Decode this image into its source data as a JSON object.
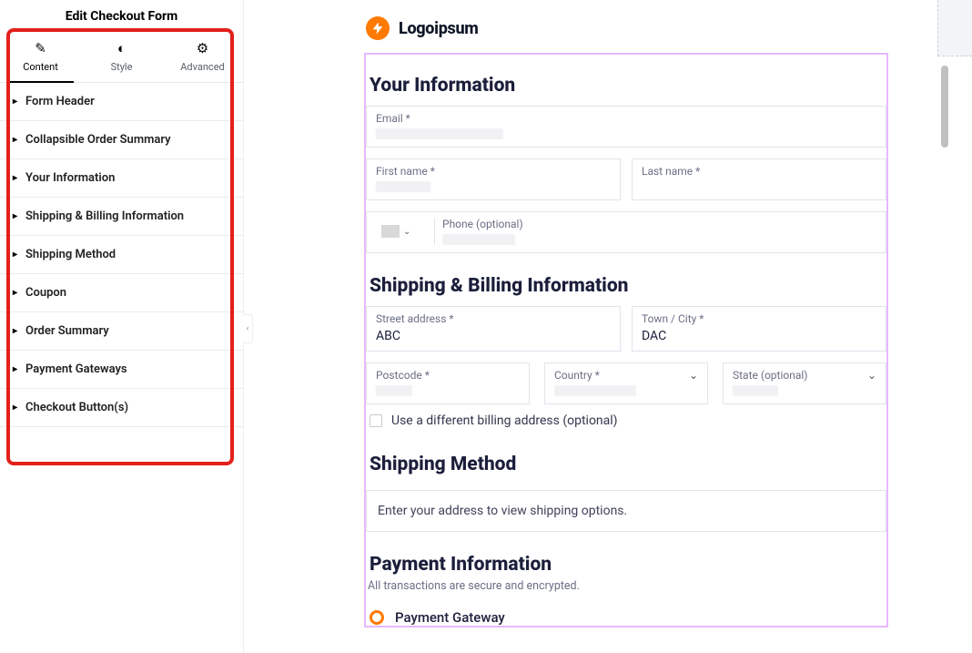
{
  "panel": {
    "title": "Edit Checkout Form",
    "tabs": {
      "content": "Content",
      "style": "Style",
      "advanced": "Advanced"
    },
    "sections": [
      "Form Header",
      "Collapsible Order Summary",
      "Your Information",
      "Shipping & Billing Information",
      "Shipping Method",
      "Coupon",
      "Order Summary",
      "Payment Gateways",
      "Checkout Button(s)"
    ]
  },
  "brand": {
    "name": "Logoipsum"
  },
  "colors": {
    "accent": "#ff7a00",
    "highlight": "#e3201c",
    "card_border": "#e8b8ff"
  },
  "form": {
    "your_info": {
      "heading": "Your Information",
      "email_label": "Email *",
      "first_label": "First name *",
      "last_label": "Last name *",
      "phone_label": "Phone (optional)"
    },
    "shipping_billing": {
      "heading": "Shipping & Billing Information",
      "street_label": "Street address *",
      "street_value": "ABC",
      "town_label": "Town / City *",
      "town_value": "DAC",
      "postcode_label": "Postcode *",
      "country_label": "Country *",
      "state_label": "State (optional)",
      "diff_billing": "Use a different billing address (optional)"
    },
    "shipping_method": {
      "heading": "Shipping Method",
      "note": "Enter your address to view shipping options."
    },
    "payment": {
      "heading": "Payment Information",
      "sub": "All transactions are secure and encrypted.",
      "gateway_label": "Payment Gateway"
    }
  }
}
